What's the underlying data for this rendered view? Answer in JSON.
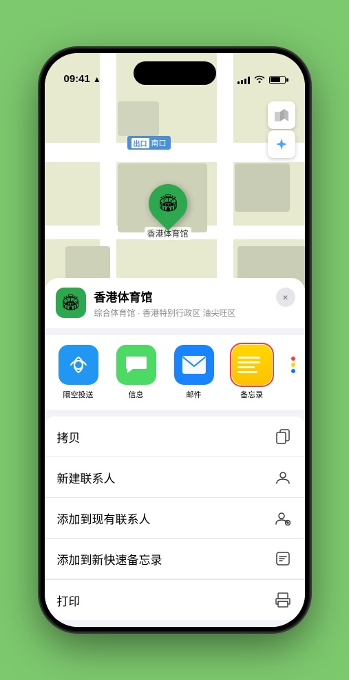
{
  "status_bar": {
    "time": "09:41",
    "location_indicator": "▲"
  },
  "map": {
    "label": "南口",
    "label_prefix": "出口"
  },
  "venue": {
    "name": "香港体育馆",
    "subtitle": "综合体育馆 · 香港特别行政区 油尖旺区",
    "pin_label": "香港体育馆",
    "icon": "🏟"
  },
  "share_apps": [
    {
      "id": "airdrop",
      "label": "隔空投送",
      "icon": "📡"
    },
    {
      "id": "messages",
      "label": "信息",
      "icon": "💬"
    },
    {
      "id": "mail",
      "label": "邮件",
      "icon": "✉"
    },
    {
      "id": "notes",
      "label": "备忘录",
      "selected": true
    }
  ],
  "actions": [
    {
      "id": "copy",
      "label": "拷贝",
      "icon": "copy"
    },
    {
      "id": "new-contact",
      "label": "新建联系人",
      "icon": "person"
    },
    {
      "id": "add-existing",
      "label": "添加到现有联系人",
      "icon": "person-plus"
    },
    {
      "id": "add-note",
      "label": "添加到新快速备忘录",
      "icon": "note"
    },
    {
      "id": "print",
      "label": "打印",
      "icon": "printer"
    }
  ],
  "close_button": "×",
  "more_colors": [
    "#ff3b30",
    "#ffd700",
    "#007aff"
  ]
}
